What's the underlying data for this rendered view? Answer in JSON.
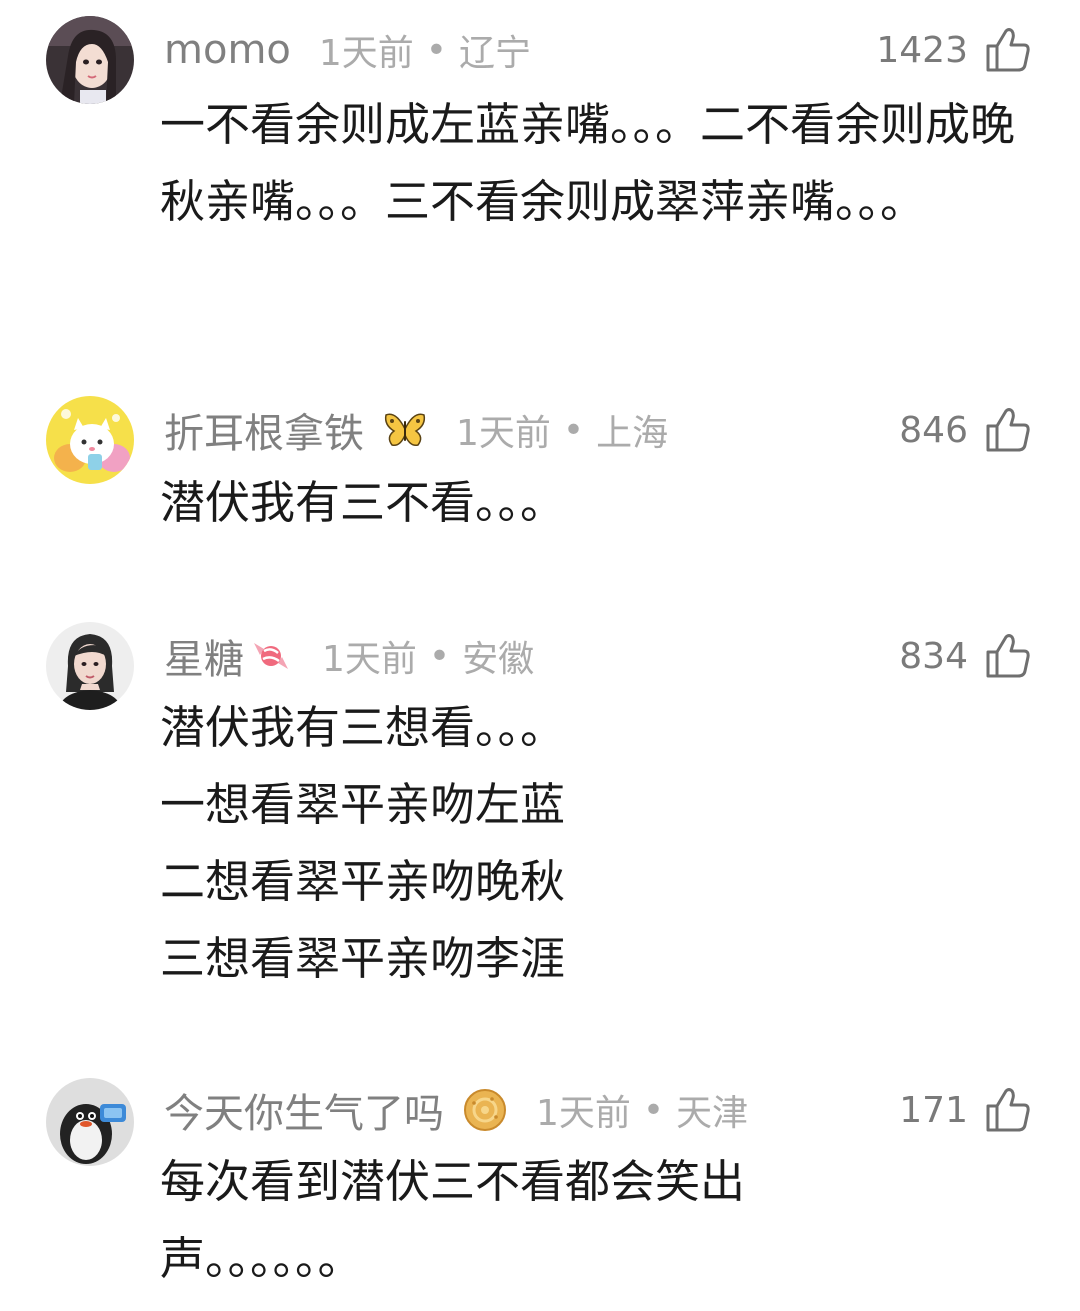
{
  "comments": [
    {
      "username": "momo",
      "time": "1天前",
      "separator": "•",
      "region": "辽宁",
      "likes": "1423",
      "avatar_icon": "girl-avatar-icon",
      "text": "一不看余则成左蓝亲嘴。。。二不看余则成晚秋亲嘴。。。三不看余则成翠萍亲嘴。。。"
    },
    {
      "username": "折耳根拿铁",
      "badge_icon": "butterfly-icon",
      "time": "1天前",
      "separator": "•",
      "region": "上海",
      "likes": "846",
      "avatar_icon": "cartoon-cat-avatar-icon",
      "text": "潜伏我有三不看。。。"
    },
    {
      "username": "星糖",
      "badge_icon": "candy-icon",
      "time": "1天前",
      "separator": "•",
      "region": "安徽",
      "likes": "834",
      "avatar_icon": "woman-portrait-avatar-icon",
      "text": "潜伏我有三想看。。。\n一想看翠平亲吻左蓝\n二想看翠平亲吻晚秋\n三想看翠平亲吻李涯"
    },
    {
      "username": "今天你生气了吗",
      "badge_icon": "cookie-icon",
      "time": "1天前",
      "separator": "•",
      "region": "天津",
      "likes": "171",
      "avatar_icon": "penguin-avatar-icon",
      "text": "每次看到潜伏三不看都会笑出声。。。。。。"
    }
  ],
  "colors": {
    "username": "#808080",
    "meta": "#ababab",
    "likes": "#7a7a7a",
    "text": "#1a1a1a"
  }
}
